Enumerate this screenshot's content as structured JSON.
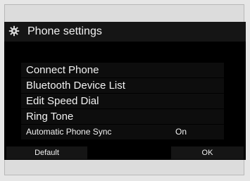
{
  "header": {
    "title": "Phone settings",
    "icon": "gear-icon"
  },
  "menu": {
    "items": [
      {
        "label": "Connect Phone"
      },
      {
        "label": "Bluetooth Device List"
      },
      {
        "label": "Edit Speed Dial"
      },
      {
        "label": "Ring Tone"
      },
      {
        "label": "Automatic Phone Sync",
        "value": "On"
      }
    ]
  },
  "softkeys": {
    "left_label": "Default",
    "right_label": "OK"
  },
  "colors": {
    "background": "#e6e6e6",
    "screen": "#000000",
    "text": "#f2f2f2"
  }
}
